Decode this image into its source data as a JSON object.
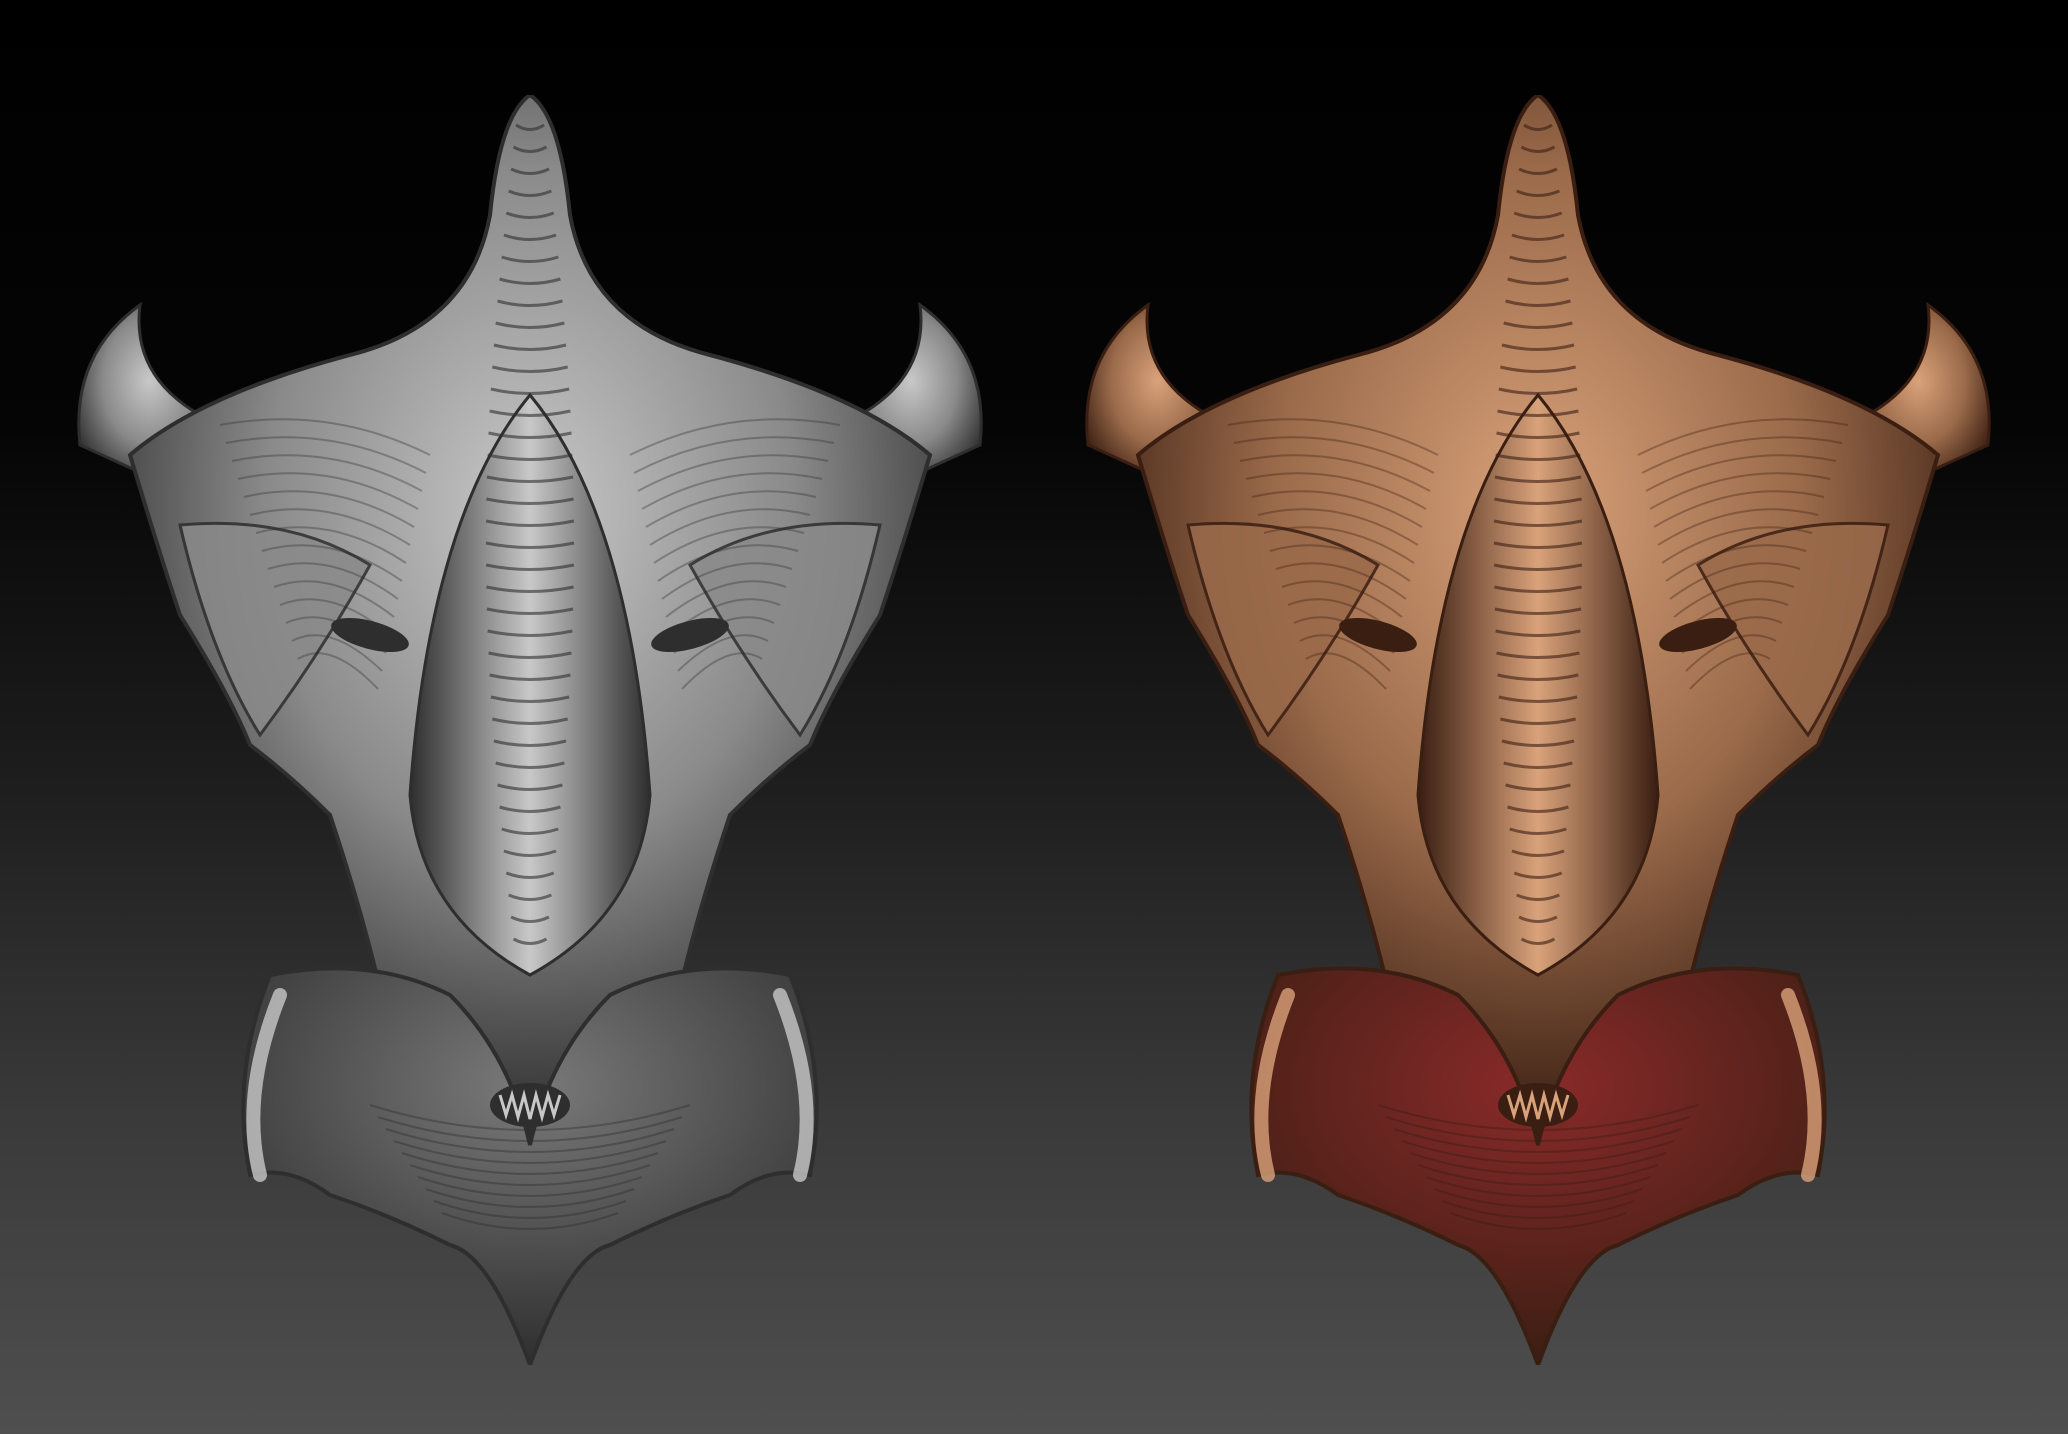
{
  "scene": {
    "background_top": "#000000",
    "background_bottom": "#4f4f4f",
    "models": [
      {
        "id": "left",
        "material": "matcap-grey",
        "base": "#8a8a8a",
        "light": "#c8c8c8",
        "dark": "#2e2e2e",
        "accent": "#7a7a7a"
      },
      {
        "id": "right",
        "material": "painted-skin",
        "base": "#9a6a4a",
        "light": "#d9a27a",
        "dark": "#3a1e12",
        "accent": "#8a2a2a"
      }
    ]
  }
}
